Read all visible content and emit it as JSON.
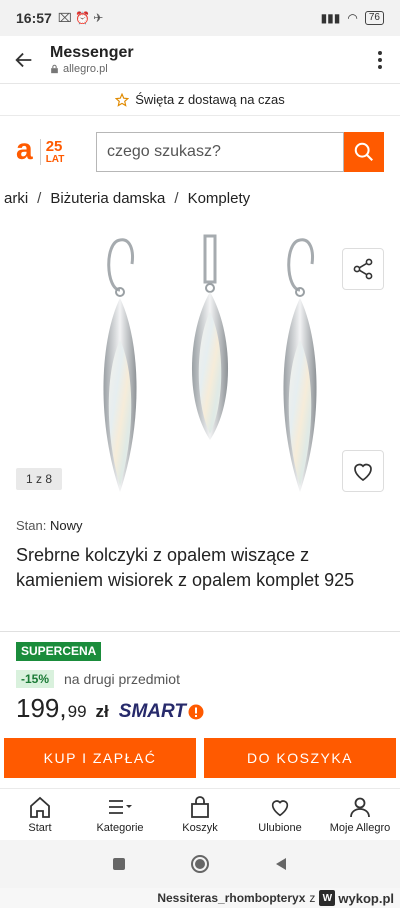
{
  "status_bar": {
    "time": "16:57",
    "battery": "76"
  },
  "browser": {
    "title": "Messenger",
    "url": "allegro.pl"
  },
  "promo": {
    "text": "Święta z dostawą na czas"
  },
  "logo": {
    "letter": "a",
    "anniversary_number": "25",
    "anniversary_word": "LAT"
  },
  "search": {
    "placeholder": "czego szukasz?"
  },
  "breadcrumb": {
    "items": [
      "arki",
      "Biżuteria damska",
      "Komplety"
    ]
  },
  "gallery": {
    "counter": "1 z 8"
  },
  "product": {
    "condition_label": "Stan:",
    "condition_value": "Nowy",
    "title": "Srebrne kolczyki z opalem wiszące z kamieniem wisiorek z opalem komplet 925"
  },
  "pricing": {
    "badge": "SUPERCENA",
    "discount": "-15%",
    "discount_text": "na drugi przedmiot",
    "price_main": "199,",
    "price_cents": "99",
    "currency": "zł",
    "smart_label": "SMART"
  },
  "actions": {
    "buy_now": "KUP I ZAPŁAĆ",
    "add_to_cart": "DO KOSZYKA"
  },
  "bottom_nav": {
    "items": [
      {
        "label": "Start",
        "icon": "home-icon"
      },
      {
        "label": "Kategorie",
        "icon": "menu-icon"
      },
      {
        "label": "Koszyk",
        "icon": "bag-icon"
      },
      {
        "label": "Ulubione",
        "icon": "heart-icon"
      },
      {
        "label": "Moje Allegro",
        "icon": "user-icon"
      }
    ]
  },
  "footer": {
    "user": "Nessiteras_rhombopteryx",
    "connector": "z",
    "site": "wykop.pl"
  },
  "colors": {
    "accent": "#ff5a00",
    "supercena": "#1a8c3b",
    "smart": "#272a6b"
  }
}
